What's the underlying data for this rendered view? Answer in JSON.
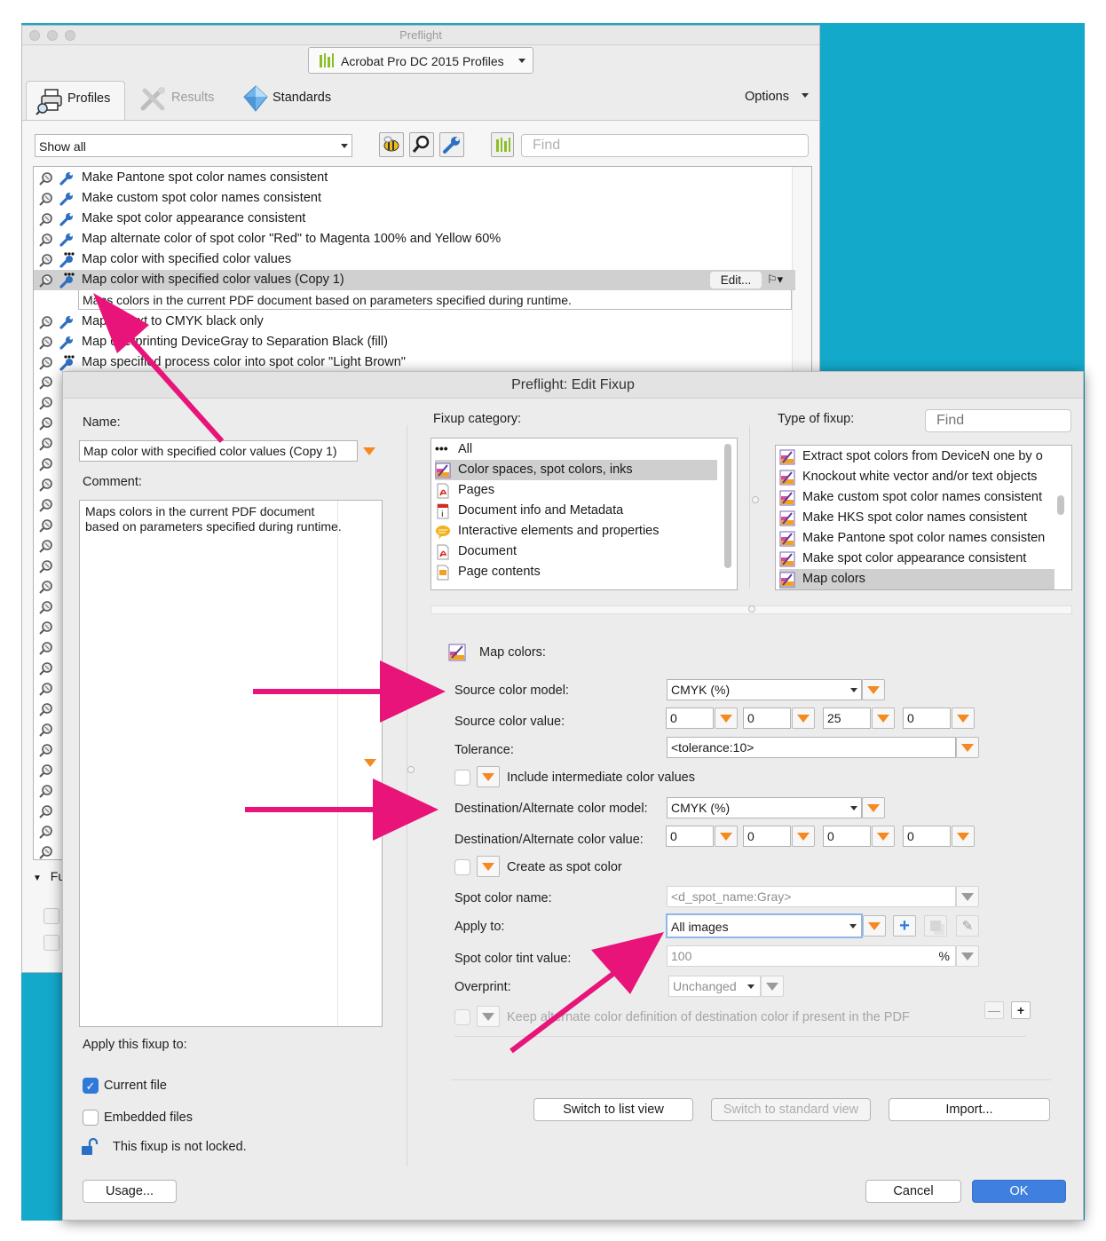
{
  "colors": {
    "backdrop": "#13a9cb",
    "arrow": "#e8147a",
    "accent_orange": "#f5891f",
    "primary_blue": "#3f7fde"
  },
  "preflight": {
    "title": "Preflight",
    "profile_dropdown": "Acrobat Pro DC 2015 Profiles",
    "tabs": {
      "profiles": "Profiles",
      "results": "Results",
      "standards": "Standards",
      "options": "Options"
    },
    "filter": "Show all",
    "find_placeholder": "Find",
    "list": [
      "Make Pantone spot color names consistent",
      "Make custom spot color names consistent",
      "Make spot color appearance consistent",
      "Map alternate color of spot color \"Red\" to Magenta 100% and Yellow 60%",
      "Map color with specified color values",
      "Map color with specified color values (Copy 1)",
      "Map all text to CMYK black only",
      "Map overprinting DeviceGray to Separation Black (fill)",
      "Map specified process color into spot color \"Light Brown\""
    ],
    "edit_button": "Edit...",
    "selected_description": "Maps colors in the current PDF document based on parameters specified during runtime.",
    "collapsed_label": "Fu"
  },
  "dialog": {
    "title": "Preflight: Edit Fixup",
    "name_label": "Name:",
    "name_value": "Map color with specified color values (Copy 1)",
    "comment_label": "Comment:",
    "comment_value": "Maps colors in the current PDF document based on parameters specified during runtime.",
    "apply_this_label": "Apply this fixup to:",
    "current_file": "Current file",
    "embedded_files": "Embedded files",
    "lock_text": "This fixup is not locked.",
    "usage_button": "Usage...",
    "category_label": "Fixup category:",
    "categories": [
      "All",
      "Color spaces, spot colors, inks",
      "Pages",
      "Document info and Metadata",
      "Interactive elements and properties",
      "Document",
      "Page contents"
    ],
    "type_label": "Type of fixup:",
    "type_find_placeholder": "Find",
    "types": [
      "Extract spot colors from DeviceN one by o",
      "Knockout white vector and/or text objects",
      "Make custom spot color names consistent",
      "Make HKS spot color names consistent",
      "Make Pantone spot color names consisten",
      "Make spot color appearance consistent",
      "Map colors"
    ],
    "section_title": "Map colors:",
    "source_model_label": "Source color model:",
    "source_model_value": "CMYK (%)",
    "source_value_label": "Source color value:",
    "source_values": [
      "0",
      "0",
      "25",
      "0"
    ],
    "tolerance_label": "Tolerance:",
    "tolerance_value": "<tolerance:10>",
    "intermediate_label": "Include intermediate color values",
    "dest_model_label": "Destination/Alternate color model:",
    "dest_model_value": "CMYK (%)",
    "dest_value_label": "Destination/Alternate color value:",
    "dest_values": [
      "0",
      "0",
      "0",
      "0"
    ],
    "spot_create_label": "Create as spot color",
    "spot_name_label": "Spot color name:",
    "spot_name_value": "<d_spot_name:Gray>",
    "apply_to_label": "Apply to:",
    "apply_to_value": "All images",
    "tint_label": "Spot color tint value:",
    "tint_value": "100",
    "tint_unit": "%",
    "overprint_label": "Overprint:",
    "overprint_value": "Unchanged",
    "keep_alt_label": "Keep alternate color definition of destination color if present in the PDF",
    "switch_list": "Switch to list view",
    "switch_standard": "Switch to standard view",
    "import_button": "Import...",
    "cancel_button": "Cancel",
    "ok_button": "OK"
  }
}
